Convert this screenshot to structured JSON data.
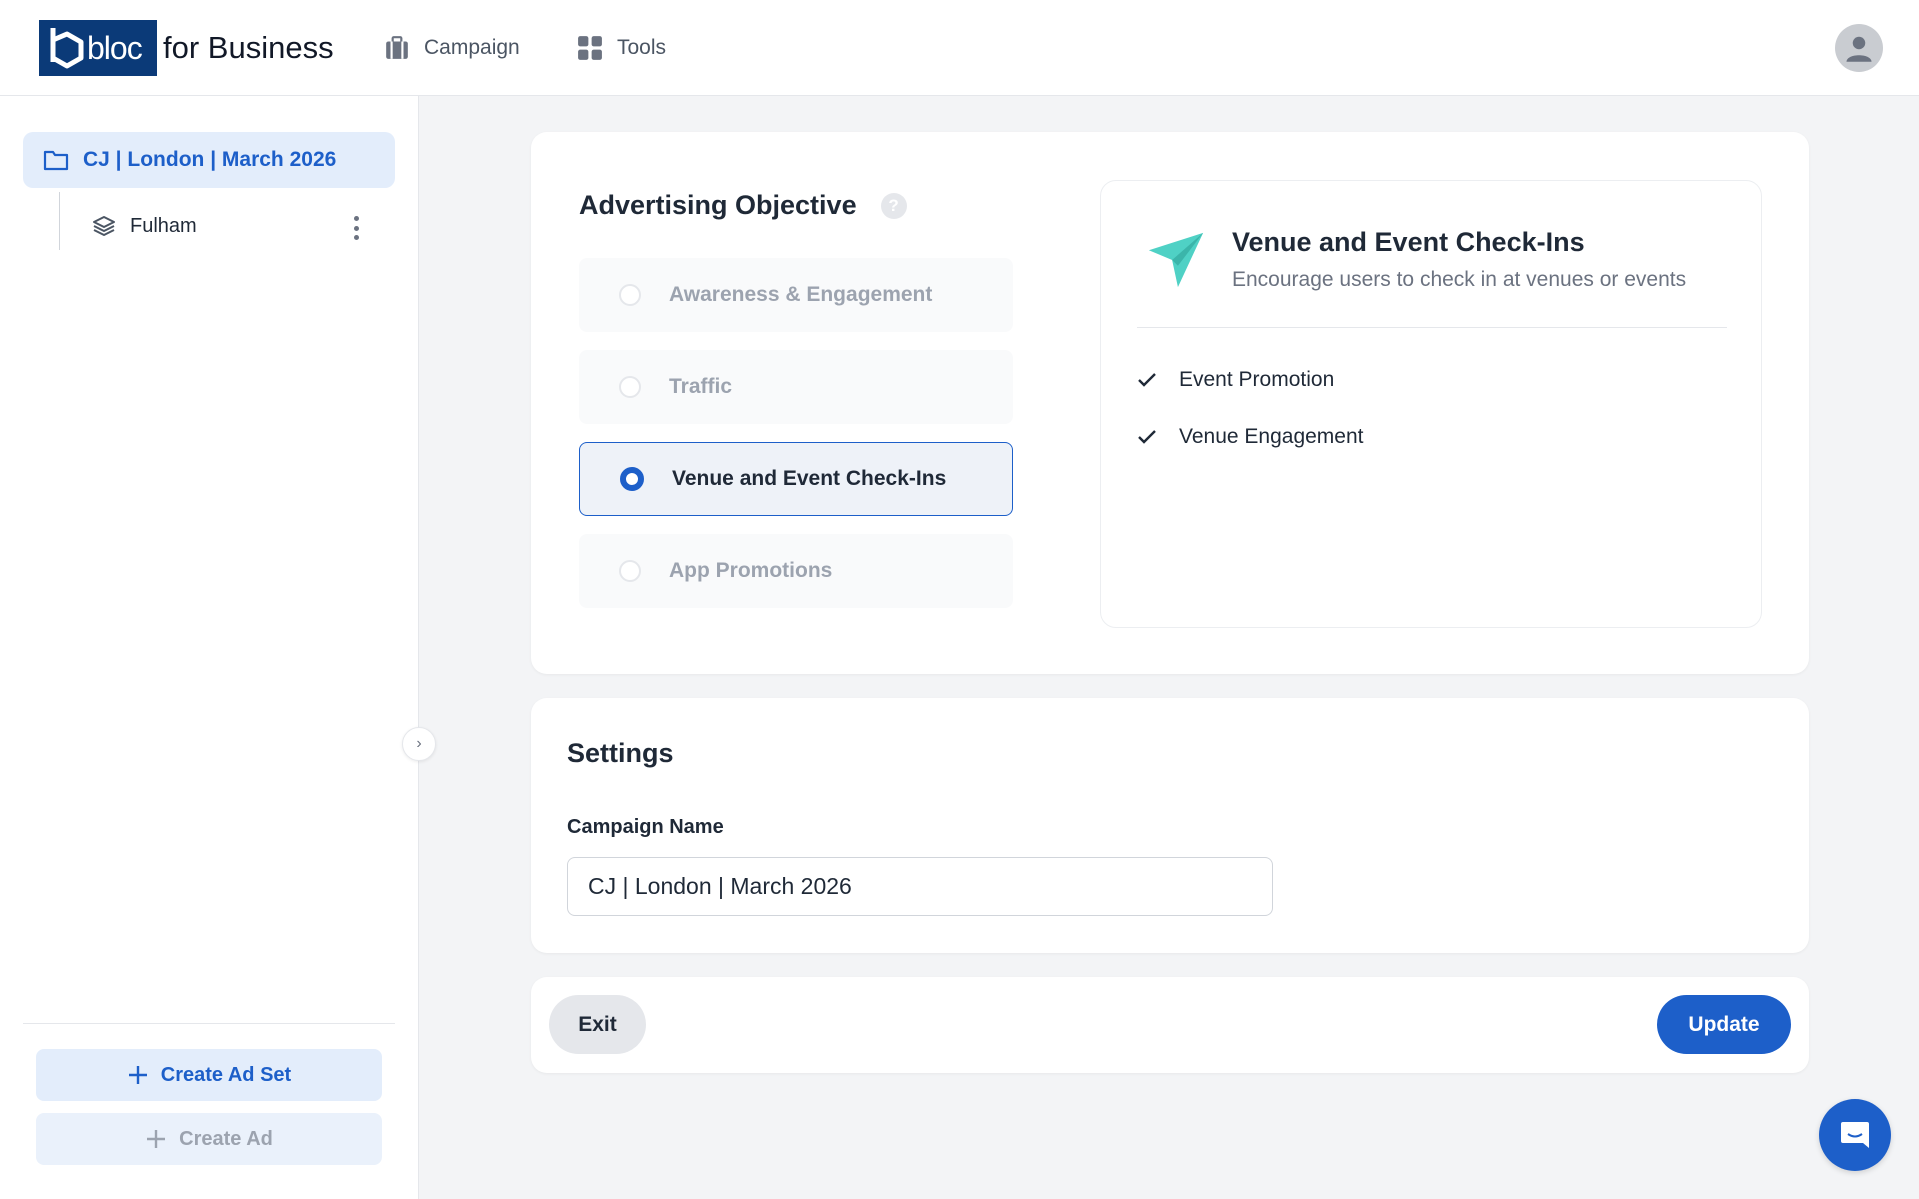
{
  "header": {
    "logo_text": "bloc",
    "logo_suffix": "for Business",
    "nav": [
      {
        "label": "Campaign",
        "icon": "briefcase-icon"
      },
      {
        "label": "Tools",
        "icon": "grid-icon"
      }
    ],
    "avatar_icon": "user-icon"
  },
  "sidebar": {
    "campaign": {
      "label": "CJ | London | March 2026",
      "icon": "folder-icon"
    },
    "ad_sets": [
      {
        "label": "Fulham",
        "icon": "layers-icon"
      }
    ],
    "create_ad_set_label": "Create Ad Set",
    "create_ad_label": "Create Ad"
  },
  "objective": {
    "title": "Advertising Objective",
    "help": "?",
    "options": [
      {
        "label": "Awareness & Engagement",
        "selected": false,
        "enabled": false
      },
      {
        "label": "Traffic",
        "selected": false,
        "enabled": false
      },
      {
        "label": "Venue and Event Check-Ins",
        "selected": true,
        "enabled": true
      },
      {
        "label": "App Promotions",
        "selected": false,
        "enabled": false
      }
    ],
    "detail": {
      "icon": "paper-plane-icon",
      "title": "Venue and Event Check-Ins",
      "subtitle": "Encourage users to check in at venues or events",
      "features": [
        "Event Promotion",
        "Venue Engagement"
      ]
    }
  },
  "settings": {
    "title": "Settings",
    "campaign_name_label": "Campaign Name",
    "campaign_name_value": "CJ | London | March 2026"
  },
  "actions": {
    "exit_label": "Exit",
    "update_label": "Update"
  },
  "colors": {
    "brand": "#0b3a78",
    "accent": "#1d5fc9",
    "accent_light": "#e3edfb",
    "teal": "#4fd1c5"
  }
}
